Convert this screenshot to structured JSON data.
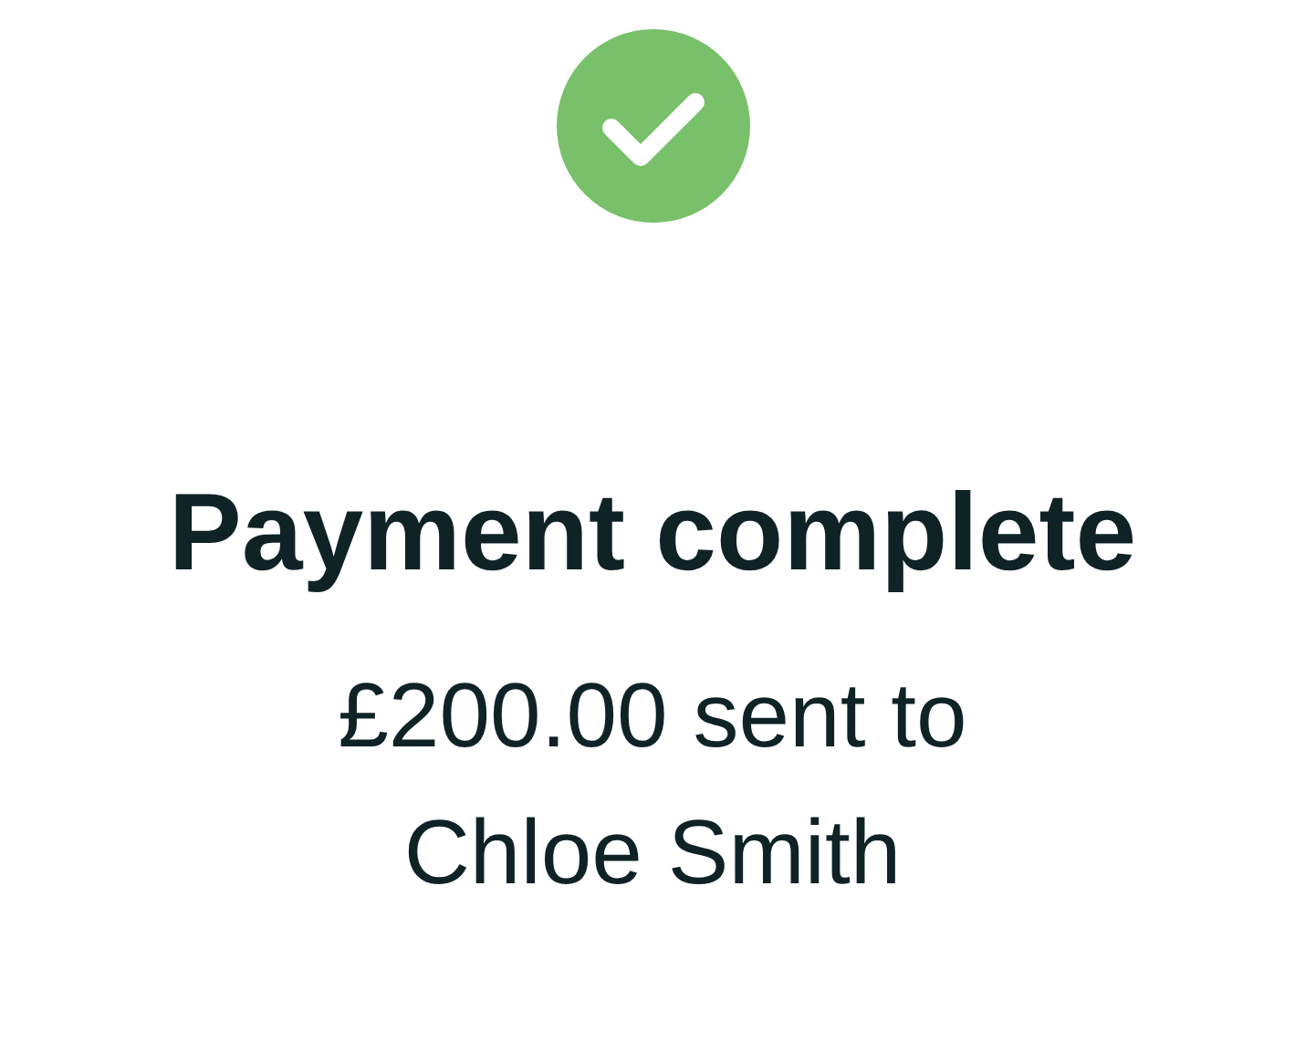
{
  "status": {
    "kind": "success"
  },
  "title": "Payment complete",
  "message": "£200.00 sent to Chloe Smith"
}
